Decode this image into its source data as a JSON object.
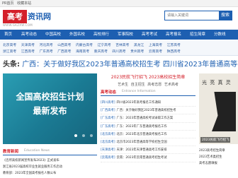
{
  "topbar": {
    "links": [
      "PR首页",
      "收藏本站"
    ]
  },
  "logo": {
    "red_text": "高考",
    "blue_text": "资讯网",
    "url_text": "WWW.GKZXW.COM"
  },
  "search": {
    "placeholder": "请输入关键词",
    "button_label": "搜索"
  },
  "nav": {
    "items": [
      "首页",
      "高考动态",
      "中国高校",
      "外国名校",
      "高校排行",
      "军事院校",
      "高考考试",
      "高考报名",
      "招生简章",
      "分数线"
    ]
  },
  "subnav": {
    "row1": [
      "北京高考",
      "天津高考",
      "河北高考",
      "山西高考",
      "内蒙古高考",
      "辽宁高考",
      "吉林高考",
      "黑龙江",
      "上海高考",
      "江苏高考"
    ],
    "row2": [
      "浙江高考",
      "江西高考",
      "广东高考",
      "广西高考",
      "海南高考",
      "重庆高考",
      "四川高考",
      "贵州高考",
      "云南高考",
      "陕西高考"
    ]
  },
  "headline": {
    "label": "头条:",
    "text": "广西：关于做好我区2023年普通高校招生考   四川省2023年普通高等学校招生"
  },
  "banner": {
    "line1": "全国高校招生计划",
    "line2": "最新发布"
  },
  "promo": {
    "title": "2023民航飞行招飞  2023高校招生简章",
    "links": [
      "艺术生",
      "自主招生",
      "高考志愿",
      "艺术高考"
    ]
  },
  "news": {
    "title": "高考动态",
    "subtitle": "Entrance Information",
    "items": [
      {
        "tag": "[四川高考]",
        "text": "四川省2023年高考报名工作通知"
      },
      {
        "tag": "[广西高考]",
        "text": "广西：关于做好我区2023年普通高校招生考"
      },
      {
        "tag": "[广东高考]",
        "text": "广东：2023年普通高校考试录取工作方案"
      },
      {
        "tag": "[广东高考]",
        "text": "广东：2023年广东普通高考报名工作"
      },
      {
        "tag": "[北京高考]",
        "text": "北京：2023年北京普通高考报名工作"
      },
      {
        "tag": "[北京高考]",
        "text": "北京市2023年普通高等学校招生全国"
      },
      {
        "tag": "[天津高考]",
        "text": "天津：2023年天津普通高考工作安排"
      },
      {
        "tag": "[云南高考]",
        "text": "云南：2023年云南普通高考招生考试"
      }
    ]
  },
  "side_image": {
    "calligraphy": "光 亮 真 灵",
    "caption": "2023民航飞行招飞"
  },
  "education": {
    "title": "教育新闻",
    "subtitle": "Education News",
    "items": [
      "《百所高校新闻宣传发布2023》正式发布",
      "浙江省2023届高校毕业生就业服务工作启动",
      "教育部：2023年全国高考报名人数公布"
    ]
  },
  "side_list": {
    "items": [
      "2023高考招生简章",
      "2023艺术类招生",
      "高考志愿填报"
    ]
  }
}
